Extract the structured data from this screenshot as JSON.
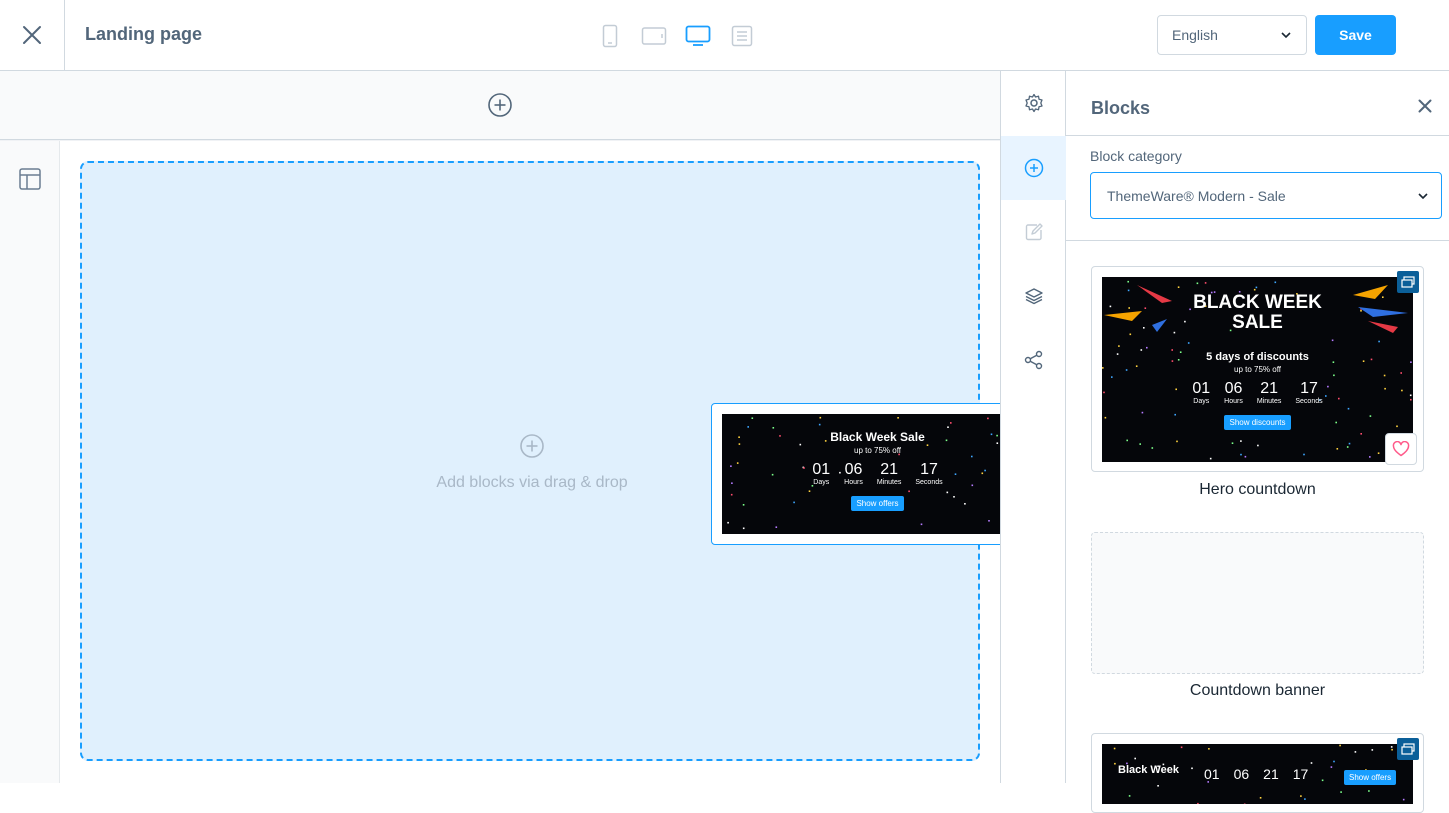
{
  "header": {
    "title": "Landing page",
    "language": "English",
    "save_label": "Save",
    "devices": [
      "mobile",
      "tablet",
      "desktop",
      "list"
    ],
    "active_device": "desktop"
  },
  "canvas": {
    "dropzone_label": "Add blocks via drag & drop"
  },
  "drag_preview": {
    "title": "Black Week Sale",
    "subtitle": "up to 75% off",
    "counters": [
      {
        "num": "01",
        "cap": "Days"
      },
      {
        "num": "06",
        "cap": "Hours"
      },
      {
        "num": "21",
        "cap": "Minutes"
      },
      {
        "num": "17",
        "cap": "Seconds"
      }
    ],
    "button": "Show offers"
  },
  "sidebar_nav": [
    "gear-icon",
    "plus-circle-icon",
    "edit-icon",
    "layers-icon",
    "share-icon"
  ],
  "panel": {
    "title": "Blocks",
    "category_label": "Block category",
    "category_value": "ThemeWare® Modern - Sale",
    "blocks": [
      {
        "label": "Hero countdown",
        "title_line1": "BLACK WEEK",
        "title_line2": "SALE",
        "subtitle": "5 days of discounts",
        "subtitle2": "up to 75% off",
        "counters": [
          {
            "num": "01",
            "cap": "Days"
          },
          {
            "num": "06",
            "cap": "Hours"
          },
          {
            "num": "21",
            "cap": "Minutes"
          },
          {
            "num": "17",
            "cap": "Seconds"
          }
        ],
        "button": "Show discounts"
      },
      {
        "label": "Countdown banner"
      },
      {
        "title": "Black Week",
        "counters": [
          "01",
          "06",
          "21",
          "17"
        ],
        "button": "Show offers"
      }
    ]
  },
  "colors": {
    "accent": "#189eff",
    "text": "#52667a",
    "dropzone_bg": "#e0f0fd",
    "badge": "#0b5f99"
  }
}
